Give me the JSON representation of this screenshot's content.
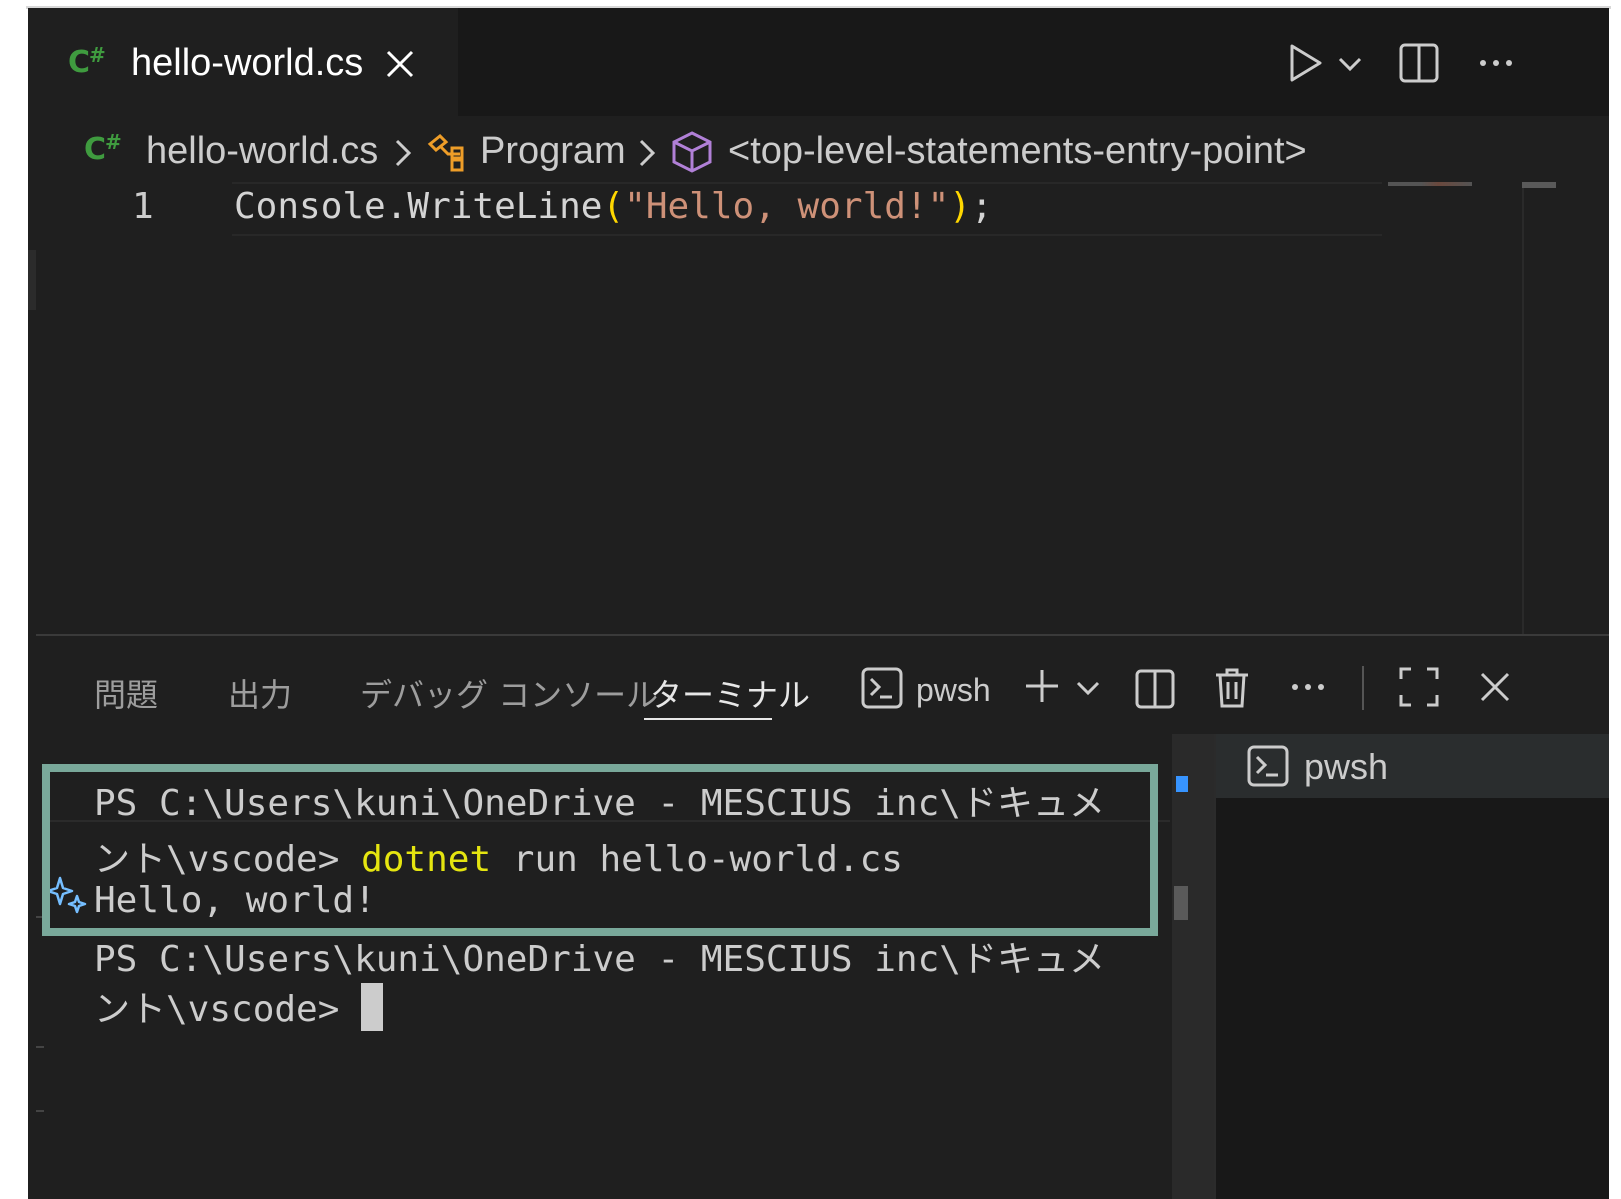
{
  "editor_tab": {
    "lang_badge": "C#",
    "title": "hello-world.cs"
  },
  "breadcrumb": {
    "file": "hello-world.cs",
    "class": "Program",
    "member": "<top-level-statements-entry-point>"
  },
  "code": {
    "line_number": "1",
    "tokens": {
      "receiver": "Console.WriteLine",
      "open_paren": "(",
      "string": "\"Hello, world!\"",
      "close_paren": ")",
      "semicolon": ";"
    }
  },
  "panel": {
    "tabs": [
      "問題",
      "出力",
      "デバッグ コンソール",
      "ターミナル"
    ],
    "active_tab": "ターミナル",
    "shell_name": "pwsh"
  },
  "terminal": {
    "line1": "PS C:\\Users\\kuni\\OneDrive - MESCIUS inc\\ドキュメ",
    "line2_prefix": "ント\\vscode> ",
    "line2_cmd": "dotnet",
    "line2_args": " run hello-world.cs",
    "line3": "Hello, world!",
    "line4": "PS C:\\Users\\kuni\\OneDrive - MESCIUS inc\\ドキュメ",
    "line5_prefix": "ント\\vscode> "
  },
  "terminal_list": {
    "item": "pwsh"
  },
  "colors": {
    "highlight_box": "#79a89a",
    "command": "#e5e510",
    "string": "#ce9178",
    "paren": "#ffd700",
    "csharp_badge": "#3f9b3f"
  }
}
